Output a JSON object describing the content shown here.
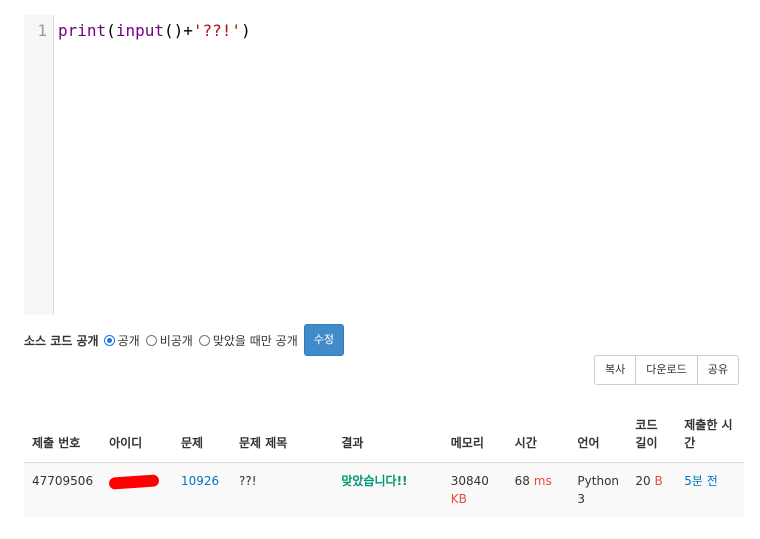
{
  "editor": {
    "line_number": "1",
    "code_tokens": [
      {
        "text": "print",
        "kind": "keyword"
      },
      {
        "text": "(",
        "kind": "plain"
      },
      {
        "text": "input",
        "kind": "keyword"
      },
      {
        "text": "()+",
        "kind": "plain"
      },
      {
        "text": "'??!'",
        "kind": "string"
      },
      {
        "text": ")",
        "kind": "plain"
      }
    ]
  },
  "visibility": {
    "label": "소스 코드 공개",
    "options": [
      {
        "label": "공개",
        "selected": true
      },
      {
        "label": "비공개",
        "selected": false
      },
      {
        "label": "맞았을 때만 공개",
        "selected": false
      }
    ],
    "edit_button": "수정"
  },
  "actions": {
    "copy": "복사",
    "download": "다운로드",
    "share": "공유"
  },
  "table": {
    "headers": {
      "submission_id": "제출 번호",
      "user_id": "아이디",
      "problem": "문제",
      "problem_title": "문제 제목",
      "result": "결과",
      "memory": "메모리",
      "time": "시간",
      "language": "언어",
      "code_length": "코드 길이",
      "submitted_at": "제출한 시간"
    },
    "row": {
      "submission_id": "47709506",
      "problem": "10926",
      "problem_title": "??!",
      "result": "맞았습니다!!",
      "memory_value": "30840",
      "memory_unit": "KB",
      "time_value": "68",
      "time_unit": "ms",
      "language": "Python 3",
      "code_length_value": "20",
      "code_length_unit": "B",
      "submitted_at": "5분 전"
    }
  },
  "colors": {
    "accent": "#428bca",
    "link": "#0076c0",
    "accepted": "#009874",
    "unit": "#e74c3c",
    "redaction": "#ff0000"
  }
}
